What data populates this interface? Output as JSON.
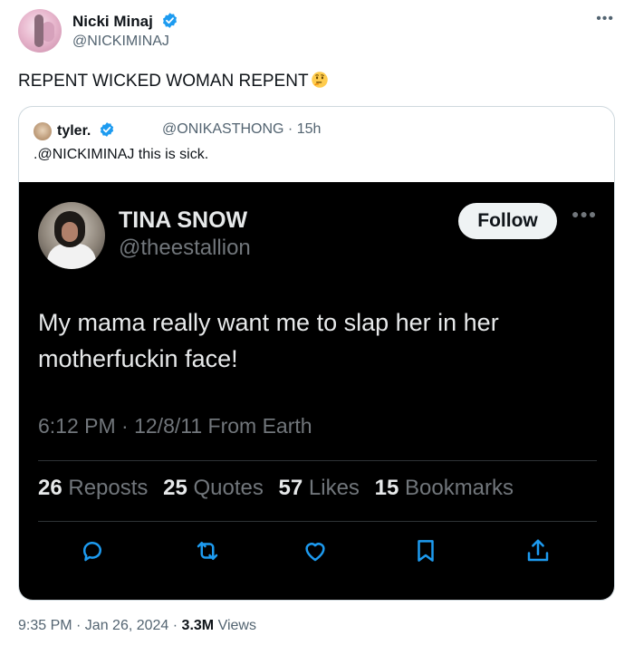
{
  "main": {
    "name": "Nicki Minaj",
    "handle": "@NICKIMINAJ",
    "text": "REPENT WICKED WOMAN REPENT",
    "emoji": "thinking-face-emoji",
    "more_icon": "more-icon",
    "verified_color": "#1d9bf0"
  },
  "quote": {
    "name": "tyler.",
    "handle_time": "@ONIKASTHONG · 15h",
    "text": ".@NICKIMINAJ this is sick."
  },
  "screenshot": {
    "name": "TINA SNOW",
    "handle": "@theestallion",
    "follow_label": "Follow",
    "text": "My mama really want me to slap her in her motherfuckin face!",
    "meta": "6:12 PM · 12/8/11 From Earth",
    "stats": [
      {
        "count": "26",
        "label": "Reposts"
      },
      {
        "count": "25",
        "label": "Quotes"
      },
      {
        "count": "57",
        "label": "Likes"
      },
      {
        "count": "15",
        "label": "Bookmarks"
      }
    ],
    "actions": [
      "reply-icon",
      "repost-icon",
      "like-icon",
      "bookmark-icon",
      "share-icon"
    ]
  },
  "footer": {
    "time": "9:35 PM · Jan 26, 2024 · ",
    "views_count": "3.3M",
    "views_label": " Views"
  }
}
